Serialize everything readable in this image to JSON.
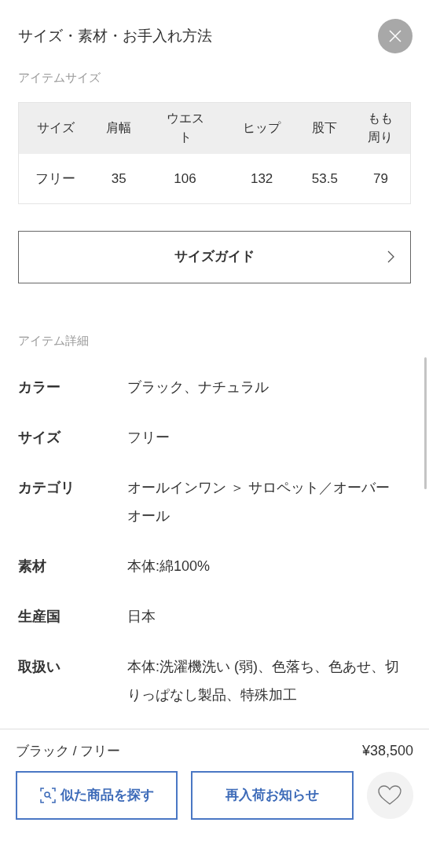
{
  "header": {
    "title": "サイズ・素材・お手入れ方法"
  },
  "size_section": {
    "heading": "アイテムサイズ",
    "columns": [
      "サイズ",
      "肩幅",
      "ウエスト",
      "ヒップ",
      "股下",
      "もも周り"
    ],
    "rows": [
      [
        "フリー",
        "35",
        "106",
        "132",
        "53.5",
        "79"
      ]
    ]
  },
  "size_guide_button": {
    "label": "サイズガイド"
  },
  "detail_section": {
    "heading": "アイテム詳細",
    "rows": [
      {
        "label": "カラー",
        "value": "ブラック、ナチュラル"
      },
      {
        "label": "サイズ",
        "value": "フリー"
      },
      {
        "label": "カテゴリ",
        "value": "オールインワン ＞ サロペット／オーバーオール"
      },
      {
        "label": "素材",
        "value": "本体:綿100%"
      },
      {
        "label": "生産国",
        "value": "日本"
      },
      {
        "label": "取扱い",
        "value": "本体:洗濯機洗い (弱)、色落ち、色あせ、切りっぱなし製品、特殊加工"
      }
    ]
  },
  "bottom_bar": {
    "variant": "ブラック / フリー",
    "price": "¥38,500",
    "buttons": [
      "似た商品を探す",
      "再入荷お知らせ"
    ],
    "favorite": {
      "selected": false
    }
  }
}
